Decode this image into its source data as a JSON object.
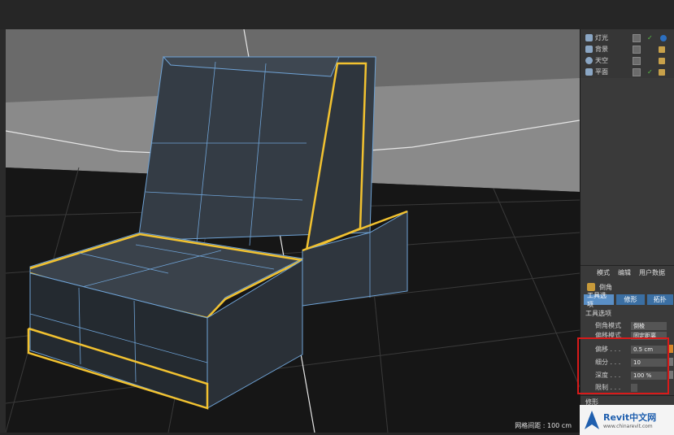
{
  "object_manager": {
    "items": [
      {
        "label": "灯光"
      },
      {
        "label": "背景"
      },
      {
        "label": "天空"
      },
      {
        "label": "平面"
      }
    ]
  },
  "attributes": {
    "menu": [
      "模式",
      "编辑",
      "用户数据"
    ],
    "tool_name": "倒角",
    "tabs": [
      "工具选项",
      "修形",
      "拓扑"
    ],
    "section": "工具选项",
    "params": [
      {
        "label": "倒角模式",
        "value": "倒棱"
      },
      {
        "label": "偏移模式",
        "value": "固定距离"
      },
      {
        "label": "偏移 . . .",
        "value": "0.5 cm"
      },
      {
        "label": "细分 . . .",
        "value": "10"
      },
      {
        "label": "深度 . . .",
        "value": "100 %"
      },
      {
        "label": "限制 . . .",
        "value": ""
      }
    ],
    "footer_label": "修形"
  },
  "viewport": {
    "grid_spacing_label": "网格间距 : 100 cm"
  },
  "watermark": {
    "name": "Revit中文网",
    "url": "www.chinarevit.com"
  },
  "colors": {
    "selection": "#f2c230",
    "wire": "#6fa3d6",
    "highlight_box": "#d81a1a"
  }
}
